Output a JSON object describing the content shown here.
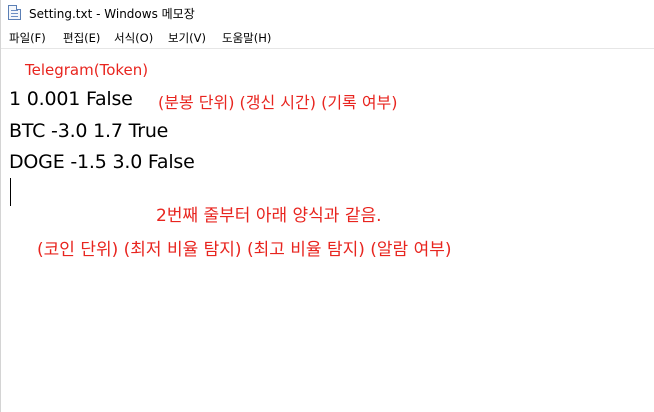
{
  "window": {
    "title": "Setting.txt - Windows 메모장",
    "icon": "notepad-icon"
  },
  "menu": {
    "items": [
      "파일(F)",
      "편집(E)",
      "서식(O)",
      "보기(V)",
      "도움말(H)"
    ]
  },
  "editor": {
    "lines": [
      "1 0.001 False",
      "BTC -3.0 1.7 True",
      "DOGE -1.5 3.0 False"
    ]
  },
  "annotations": {
    "color": "#e8251f",
    "token": "Telegram(Token)",
    "line1": "(분봉 단위) (갱신 시간) (기록 여부)",
    "note": "2번째 줄부터 아래 양식과 같음.",
    "format": "(코인 단위) (최저 비율 탐지) (최고 비율 탐지) (알람 여부)"
  }
}
